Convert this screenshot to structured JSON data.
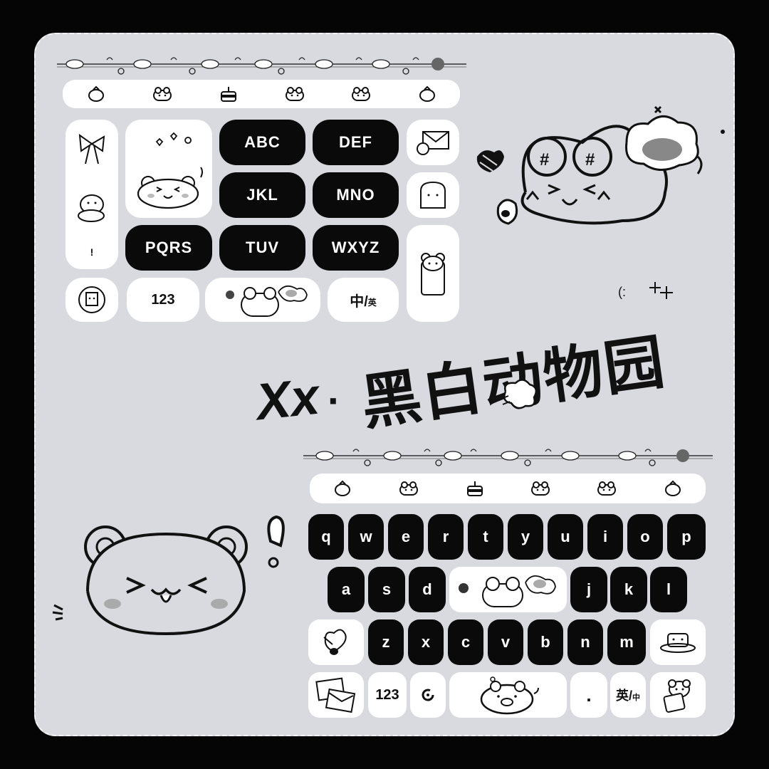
{
  "title": {
    "prefix": "Xx",
    "dot": "·",
    "main": "黑白动物园"
  },
  "t9_keyboard": {
    "toolbar_icons": [
      "carrot-icon",
      "frog-icon",
      "cake-icon",
      "frog-icon",
      "frog-icon",
      "carrot-icon"
    ],
    "keys": {
      "abc": "ABC",
      "def": "DEF",
      "jkl": "JKL",
      "mno": "MNO",
      "pqrs": "PQRS",
      "tuv": "TUV",
      "wxyz": "WXYZ",
      "num": "123",
      "lang_main": "中/",
      "lang_sub": "英"
    },
    "side_left_symbol": "!",
    "colors": {
      "dark_key": "#0a0a0a",
      "light_key": "#ffffff",
      "panel": "#d9dadf"
    }
  },
  "qwerty_keyboard": {
    "toolbar_icons": [
      "carrot-icon",
      "frog-icon",
      "cake-icon",
      "frog-icon",
      "frog-icon",
      "carrot-icon"
    ],
    "row1": [
      "q",
      "w",
      "e",
      "r",
      "t",
      "y",
      "u",
      "i",
      "o",
      "p"
    ],
    "row2_left": [
      "a",
      "s",
      "d"
    ],
    "row2_right": [
      "j",
      "k",
      "l"
    ],
    "row3": [
      "z",
      "x",
      "c",
      "v",
      "b",
      "n",
      "m"
    ],
    "bottom": {
      "num": "123",
      "period": ".",
      "lang_main": "英/",
      "lang_sub": "中"
    }
  },
  "decoration": {
    "sparkle_text": "(:"
  }
}
